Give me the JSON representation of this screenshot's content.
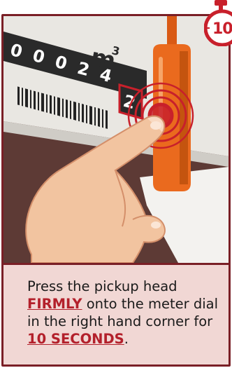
{
  "meter": {
    "digits": [
      "0",
      "0",
      "0",
      "2",
      "4",
      "2"
    ],
    "unit": "m",
    "unit_sup": "3"
  },
  "timer": {
    "label": "10"
  },
  "caption": {
    "part1": "Press the pickup head ",
    "emphasis1": "FIRMLY",
    "part2": " onto the meter dial in the right hand corner for ",
    "emphasis2": "10 SECONDS",
    "part3": "."
  },
  "colors": {
    "frame": "#7a1f26",
    "accent_red": "#b3202b",
    "caption_bg": "#f1d7d4",
    "probe_orange": "#ea6a1e"
  }
}
